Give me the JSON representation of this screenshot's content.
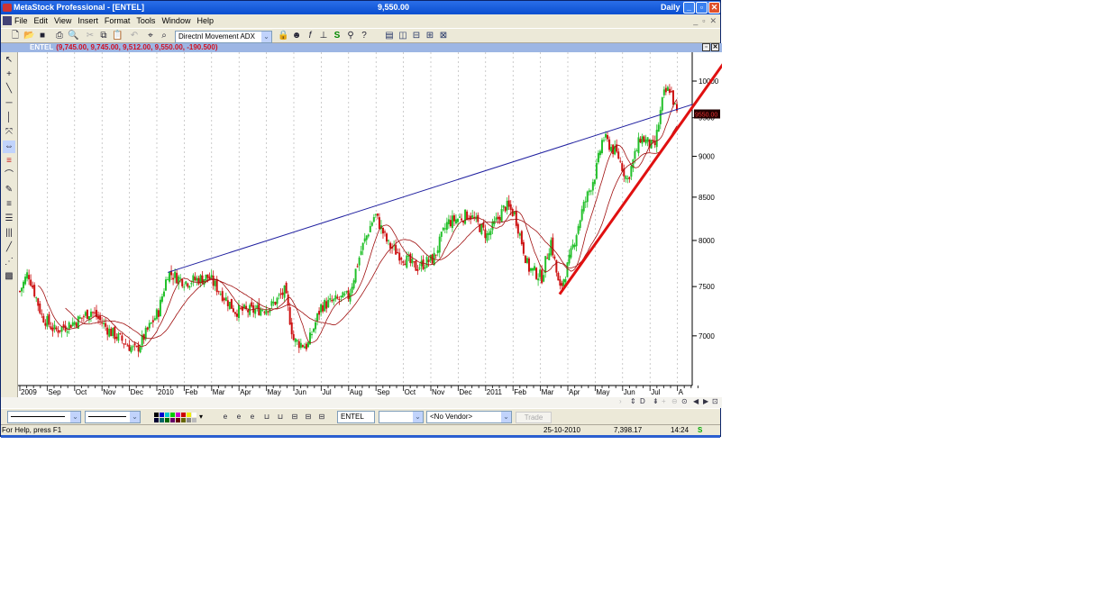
{
  "window": {
    "title": "MetaStock Professional - [ENTEL]",
    "value": "9,550.00",
    "periodicity": "Daily"
  },
  "menu": [
    "File",
    "Edit",
    "View",
    "Insert",
    "Format",
    "Tools",
    "Window",
    "Help"
  ],
  "toolbar": {
    "indicator_select": "Directnl Movement ADX"
  },
  "chart_window": {
    "symbol": "ENTEL",
    "quote": "(9,745.00, 9,745.00, 9,512.00, 9,550.00, -190.500)"
  },
  "bottom_toolbar": {
    "symbol_field": "ENTEL",
    "exchange_select": "",
    "vendor_select": "<No Vendor>",
    "trade_label": "Trade"
  },
  "status": {
    "help": "For Help, press F1",
    "date": "25-10-2010",
    "value": "7,398.17",
    "time": "14:24",
    "indicator": "S"
  },
  "scroll_controls": [
    "D"
  ],
  "colors": {
    "up": "#22c02a",
    "down": "#cc1010",
    "ma": "#a01010",
    "trend_resistance": "#2020a0",
    "trend_support": "#e01010",
    "price_label_bg": "#200000"
  },
  "chart_data": {
    "type": "candlestick",
    "title": "ENTEL",
    "y_scale": "log",
    "ylim": [
      6500,
      10400
    ],
    "y_ticks": [
      7000,
      7500,
      8000,
      8500,
      9000,
      9500,
      10000
    ],
    "y_tick_labels": [
      "7000",
      "7500",
      "8000",
      "8500",
      "9000",
      "9500",
      "10000"
    ],
    "last_price_label": "9550.00",
    "x_unit": "months since Aug 2009",
    "x_ticks": [
      "2009",
      "Sep",
      "Oct",
      "Nov",
      "Dec",
      "2010",
      "Feb",
      "Mar",
      "Apr",
      "May",
      "Jun",
      "Jul",
      "Aug",
      "Sep",
      "Oct",
      "Nov",
      "Dec",
      "2011",
      "Feb",
      "Mar",
      "Apr",
      "May",
      "Jun",
      "Jul",
      "A"
    ],
    "close_keypoints": [
      [
        0,
        7450
      ],
      [
        0.3,
        7650
      ],
      [
        0.8,
        7200
      ],
      [
        1.28,
        7050
      ],
      [
        2.1,
        7150
      ],
      [
        2.6,
        7250
      ],
      [
        3.26,
        7050
      ],
      [
        4.24,
        6850
      ],
      [
        5.07,
        7250
      ],
      [
        5.4,
        7650
      ],
      [
        6.05,
        7550
      ],
      [
        6.88,
        7600
      ],
      [
        7.86,
        7250
      ],
      [
        8.52,
        7250
      ],
      [
        9.18,
        7300
      ],
      [
        9.67,
        7450
      ],
      [
        10.0,
        6950
      ],
      [
        10.5,
        6900
      ],
      [
        11.0,
        7300
      ],
      [
        12.0,
        7400
      ],
      [
        12.47,
        7900
      ],
      [
        12.96,
        8300
      ],
      [
        13.45,
        7950
      ],
      [
        14.44,
        7700
      ],
      [
        15.1,
        7800
      ],
      [
        15.6,
        8200
      ],
      [
        16.4,
        8300
      ],
      [
        17.07,
        8050
      ],
      [
        17.73,
        8400
      ],
      [
        18.06,
        8300
      ],
      [
        18.55,
        7700
      ],
      [
        19.05,
        7600
      ],
      [
        19.38,
        8000
      ],
      [
        19.7,
        7450
      ],
      [
        20.03,
        7750
      ],
      [
        20.53,
        8350
      ],
      [
        21.02,
        8800
      ],
      [
        21.28,
        9250
      ],
      [
        21.84,
        9000
      ],
      [
        22.17,
        8700
      ],
      [
        22.66,
        9250
      ],
      [
        23.16,
        9100
      ],
      [
        23.49,
        9800
      ],
      [
        23.72,
        9900
      ],
      [
        23.98,
        9550
      ]
    ],
    "moving_averages": [
      10,
      25
    ],
    "trendlines": [
      {
        "name": "resistance",
        "from": [
          5.4,
          7650
        ],
        "to": [
          24.54,
          9677
        ]
      },
      {
        "name": "support",
        "from": [
          19.7,
          7420
        ],
        "to": [
          25.9,
          10372
        ]
      }
    ]
  }
}
